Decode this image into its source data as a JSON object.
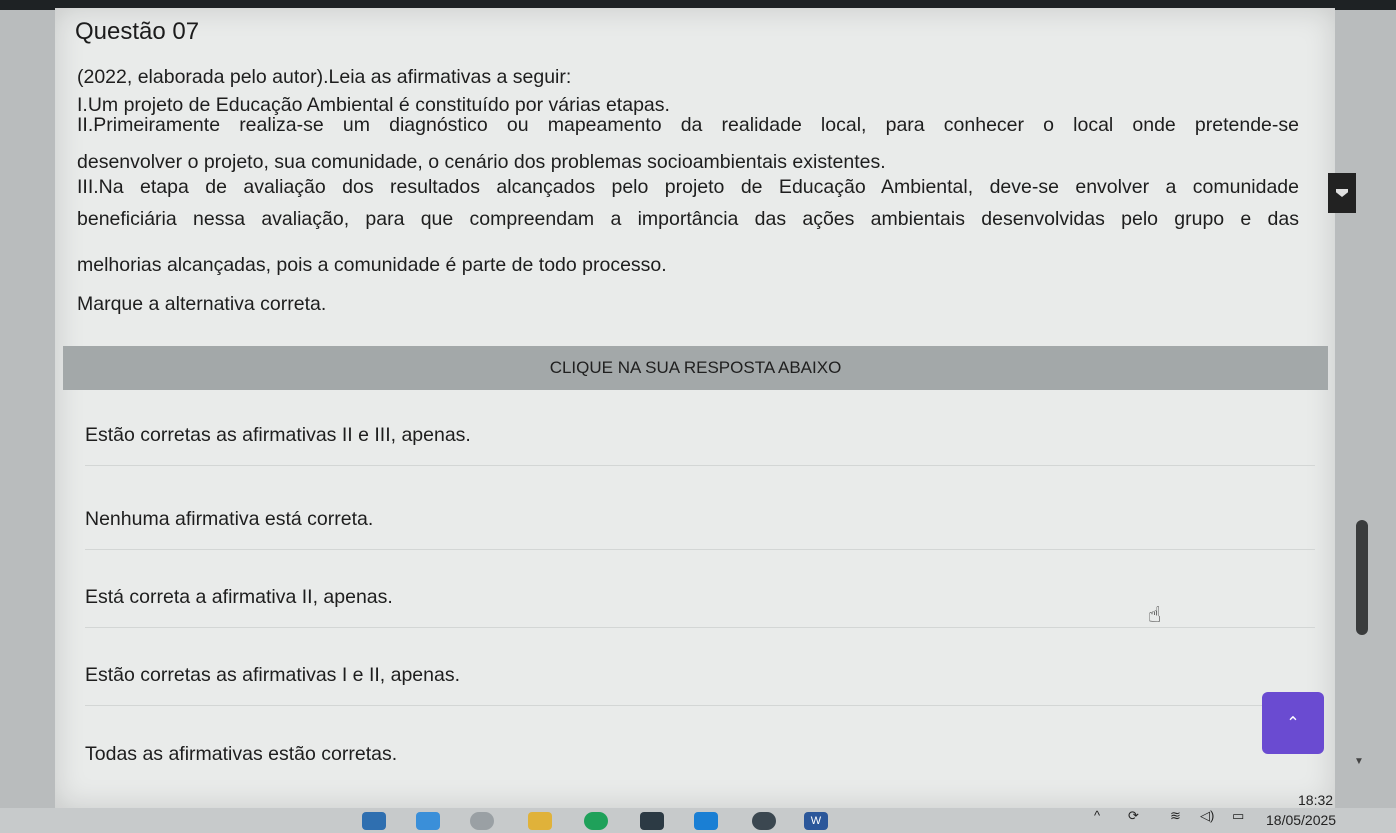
{
  "question": {
    "title": "Questão 07",
    "source": "(2022, elaborada pelo autor).Leia as afirmativas a seguir:",
    "s1": "I.Um projeto de Educação Ambiental é constituído por várias etapas.",
    "s2a": "II.Primeiramente realiza-se um diagnóstico ou mapeamento da realidade local, para conhecer o local onde pretende-se",
    "s2b": "desenvolver o projeto, sua comunidade, o cenário dos problemas socioambientais existentes.",
    "s3a": "III.Na etapa de avaliação dos resultados alcançados pelo projeto de Educação Ambiental, deve-se envolver a comunidade",
    "s3b": "beneficiária nessa avaliação, para que compreendam a importância das ações ambientais desenvolvidas pelo grupo e das",
    "s3c": "melhorias alcançadas, pois a comunidade é parte de todo processo.",
    "prompt": "Marque a alternativa correta."
  },
  "banner": "CLIQUE NA SUA RESPOSTA ABAIXO",
  "answers": [
    "Estão corretas as afirmativas II e III, apenas.",
    "Nenhuma afirmativa está correta.",
    "Está correta a afirmativa II, apenas.",
    "Estão corretas as afirmativas I e II, apenas.",
    "Todas as afirmativas estão corretas."
  ],
  "taskbar": {
    "time": "18:32",
    "date": "18/05/2025",
    "word_label": "W"
  },
  "colors": {
    "accent": "#6a4bd1",
    "banner": "#a3a8a9"
  }
}
